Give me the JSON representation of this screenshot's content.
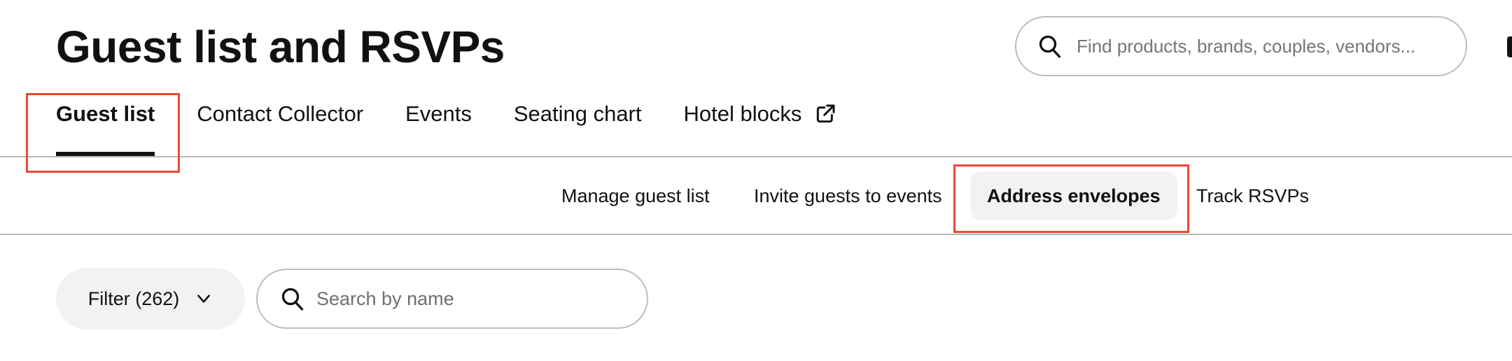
{
  "header": {
    "title": "Guest list and RSVPs",
    "search": {
      "placeholder": "Find products, brands, couples, vendors...",
      "value": "",
      "icon": "search-icon"
    }
  },
  "tabs": [
    {
      "label": "Guest list",
      "active": true
    },
    {
      "label": "Contact Collector",
      "active": false
    },
    {
      "label": "Events",
      "active": false
    },
    {
      "label": "Seating chart",
      "active": false
    },
    {
      "label": "Hotel blocks",
      "active": false,
      "icon": "external-link-icon"
    }
  ],
  "subnav": [
    {
      "label": "Manage guest list",
      "active": false
    },
    {
      "label": "Invite guests to events",
      "active": false
    },
    {
      "label": "Address envelopes",
      "active": true
    },
    {
      "label": "Track RSVPs",
      "active": false
    }
  ],
  "toolbar": {
    "filter_label": "Filter (262)",
    "filter_icon": "chevron-down-icon",
    "name_search": {
      "placeholder": "Search by name",
      "value": "",
      "icon": "search-icon"
    }
  },
  "colors": {
    "highlight": "#e84a35",
    "active_pill_bg": "#f2f2f2",
    "text": "#111111",
    "divider": "#b8b8b8"
  }
}
